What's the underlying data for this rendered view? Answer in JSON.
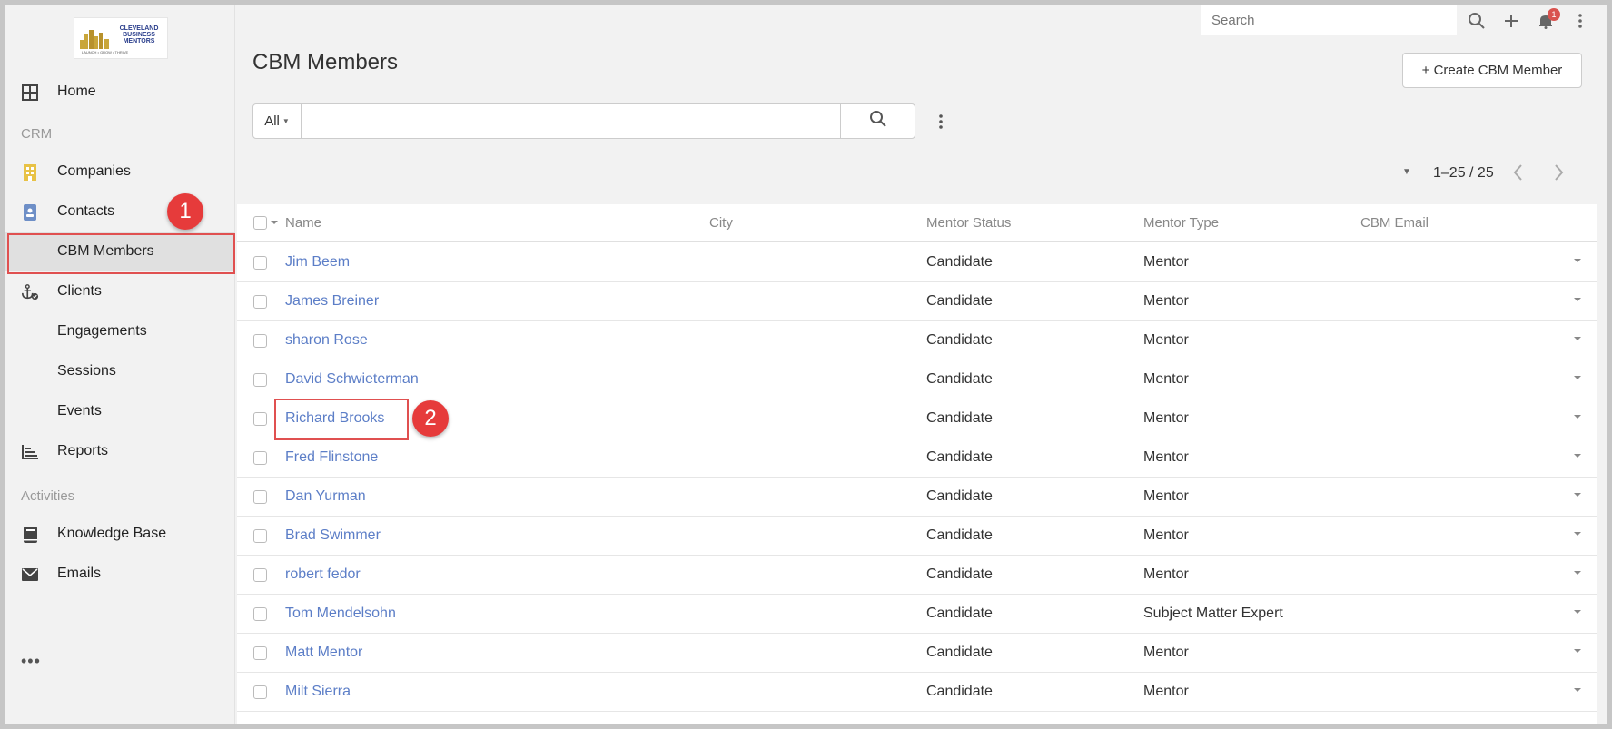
{
  "logo": {
    "line1": "CLEVELAND",
    "line2": "BUSINESS",
    "line3": "MENTORS",
    "tagline": "LAUNCH • GROW • THRIVE"
  },
  "sidebar": {
    "home": "Home",
    "group_crm": "CRM",
    "companies": "Companies",
    "contacts": "Contacts",
    "cbm_members": "CBM Members",
    "clients": "Clients",
    "engagements": "Engagements",
    "sessions": "Sessions",
    "events": "Events",
    "reports": "Reports",
    "group_activities": "Activities",
    "knowledge_base": "Knowledge Base",
    "emails": "Emails",
    "more": "•••"
  },
  "topbar": {
    "search_placeholder": "Search",
    "notification_count": "1"
  },
  "page": {
    "title": "CBM Members",
    "create_label": "+ Create CBM Member"
  },
  "filter": {
    "scope": "All"
  },
  "pagination": {
    "range": "1–25 / 25"
  },
  "table": {
    "headers": {
      "name": "Name",
      "city": "City",
      "mentor_status": "Mentor Status",
      "mentor_type": "Mentor Type",
      "cbm_email": "CBM Email"
    },
    "rows": [
      {
        "name": "Jim Beem",
        "city": "",
        "status": "Candidate",
        "type": "Mentor",
        "email": ""
      },
      {
        "name": "James Breiner",
        "city": "",
        "status": "Candidate",
        "type": "Mentor",
        "email": ""
      },
      {
        "name": "sharon Rose",
        "city": "",
        "status": "Candidate",
        "type": "Mentor",
        "email": ""
      },
      {
        "name": "David Schwieterman",
        "city": "",
        "status": "Candidate",
        "type": "Mentor",
        "email": ""
      },
      {
        "name": "Richard Brooks",
        "city": "",
        "status": "Candidate",
        "type": "Mentor",
        "email": ""
      },
      {
        "name": "Fred Flinstone",
        "city": "",
        "status": "Candidate",
        "type": "Mentor",
        "email": ""
      },
      {
        "name": "Dan Yurman",
        "city": "",
        "status": "Candidate",
        "type": "Mentor",
        "email": ""
      },
      {
        "name": "Brad Swimmer",
        "city": "",
        "status": "Candidate",
        "type": "Mentor",
        "email": ""
      },
      {
        "name": "robert fedor",
        "city": "",
        "status": "Candidate",
        "type": "Mentor",
        "email": ""
      },
      {
        "name": "Tom Mendelsohn",
        "city": "",
        "status": "Candidate",
        "type": "Subject Matter Expert",
        "email": ""
      },
      {
        "name": "Matt Mentor",
        "city": "",
        "status": "Candidate",
        "type": "Mentor",
        "email": ""
      },
      {
        "name": "Milt Sierra",
        "city": "",
        "status": "Candidate",
        "type": "Mentor",
        "email": ""
      }
    ]
  },
  "annotations": {
    "marker1": "1",
    "marker2": "2"
  },
  "colors": {
    "link": "#5c7ec7",
    "marker": "#e63b3b",
    "companies_icon": "#e8c246",
    "contacts_icon": "#6e8fc7"
  }
}
